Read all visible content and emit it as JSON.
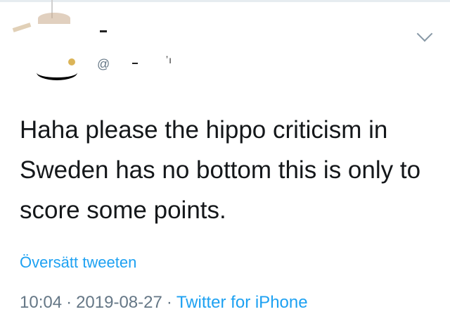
{
  "tweet": {
    "text": "Haha please the hippo criticism in Sweden has no bottom this is only to score some points.",
    "translate_label": "Översätt tweeten",
    "time": "10:04",
    "date": "2019-08-27",
    "separator": "·",
    "source": "Twitter for iPhone"
  },
  "header": {
    "handle_prefix": "@",
    "dropdown_icon": "chevron-down-icon"
  },
  "colors": {
    "link": "#1da1f2",
    "meta": "#657786",
    "text": "#14171a"
  }
}
